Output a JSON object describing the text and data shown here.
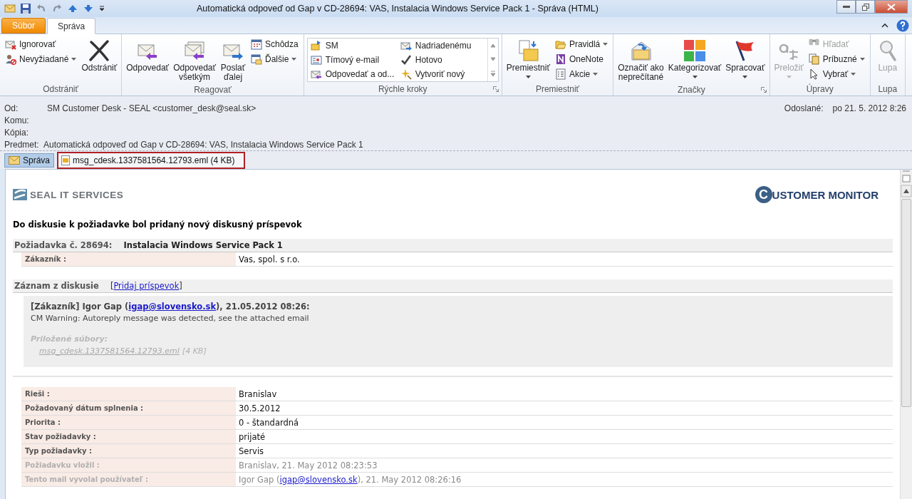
{
  "window": {
    "title": "Automatická odpoveď od Gap v CD-28694: VAS,  Instalacia Windows Service Pack 1 -  Správa (HTML)"
  },
  "ribbon_tabs": [
    {
      "label": "Súbor",
      "kind": "file",
      "selected": false
    },
    {
      "label": "Správa",
      "kind": "tab",
      "selected": true
    }
  ],
  "ribbon_groups": [
    {
      "label": "Odstrániť",
      "launcher": false,
      "columns": [
        {
          "kind": "stack",
          "items": [
            {
              "label": "Ignorovať",
              "dropdown": false,
              "disabled": false
            },
            {
              "label": "Nevyžiadané",
              "dropdown": true,
              "disabled": false
            }
          ]
        },
        {
          "kind": "large",
          "lines": [
            "Odstrániť"
          ],
          "dropdown": false,
          "disabled": false
        }
      ]
    },
    {
      "label": "Reagovať",
      "launcher": false,
      "columns": [
        {
          "kind": "large",
          "lines": [
            "Odpovedať"
          ],
          "dropdown": false,
          "disabled": false
        },
        {
          "kind": "large",
          "lines": [
            "Odpovedať",
            "všetkým"
          ],
          "dropdown": false,
          "disabled": false
        },
        {
          "kind": "large",
          "lines": [
            "Poslať",
            "ďalej"
          ],
          "dropdown": false,
          "disabled": false
        },
        {
          "kind": "stack",
          "items": [
            {
              "label": "Schôdza",
              "dropdown": false,
              "disabled": false
            },
            {
              "label": "Ďalšie",
              "dropdown": true,
              "disabled": false
            }
          ]
        }
      ]
    },
    {
      "label": "Rýchle kroky",
      "launcher": true,
      "columns": [
        {
          "kind": "gallery",
          "items": [
            {
              "label": "SM"
            },
            {
              "label": "Tímový e-mail"
            },
            {
              "label": "Odpovedať a od..."
            },
            {
              "label": "Nadriadenému"
            },
            {
              "label": "Hotovo"
            },
            {
              "label": "Vytvoriť nový"
            }
          ]
        }
      ]
    },
    {
      "label": "Premiestniť",
      "launcher": false,
      "columns": [
        {
          "kind": "large",
          "lines": [
            "Premiestniť"
          ],
          "dropdown": true,
          "disabled": false
        },
        {
          "kind": "stack",
          "items": [
            {
              "label": "Pravidlá",
              "dropdown": true,
              "disabled": false
            },
            {
              "label": "OneNote",
              "dropdown": false,
              "disabled": false
            },
            {
              "label": "Akcie",
              "dropdown": true,
              "disabled": false
            }
          ]
        }
      ]
    },
    {
      "label": "Značky",
      "launcher": true,
      "columns": [
        {
          "kind": "large",
          "lines": [
            "Označiť ako",
            "neprečítané"
          ],
          "dropdown": false,
          "disabled": false
        },
        {
          "kind": "large",
          "lines": [
            "Kategorizovať"
          ],
          "dropdown": true,
          "disabled": false
        },
        {
          "kind": "large",
          "lines": [
            "Spracovať"
          ],
          "dropdown": true,
          "disabled": false
        }
      ]
    },
    {
      "label": "Úpravy",
      "launcher": false,
      "columns": [
        {
          "kind": "large",
          "lines": [
            "Preložiť"
          ],
          "dropdown": true,
          "disabled": true
        },
        {
          "kind": "stack",
          "items": [
            {
              "label": "Hľadať",
              "dropdown": false,
              "disabled": true
            },
            {
              "label": "Príbuzné",
              "dropdown": true,
              "disabled": false
            },
            {
              "label": "Vybrať",
              "dropdown": true,
              "disabled": false
            }
          ]
        }
      ]
    },
    {
      "label": "Lupa",
      "launcher": false,
      "columns": [
        {
          "kind": "large",
          "lines": [
            "Lupa"
          ],
          "dropdown": false,
          "disabled": true
        }
      ]
    }
  ],
  "header": {
    "fields": [
      {
        "label": "Od:",
        "value": "SM Customer Desk - SEAL <customer_desk@seal.sk>"
      },
      {
        "label": "Komu:"
      },
      {
        "label": "Kópia:"
      },
      {
        "label": "Predmet:",
        "value": "Automatická odpoveď od Gap v CD-28694: VAS,  Instalacia Windows Service Pack 1"
      }
    ],
    "sent": {
      "label": "Odoslané:",
      "value": "po 21. 5. 2012 8:26"
    }
  },
  "message_tabs": [
    {
      "label": "Správa",
      "kind": "message",
      "selected": true,
      "highlighted": false
    },
    {
      "label": "msg_cdesk.1337581564.12793.eml (4 KB)",
      "kind": "attachment",
      "selected": false,
      "highlighted": true
    }
  ],
  "body": {
    "logo_left": "SEAL IT SERVICES",
    "logo_right": {
      "initial": "C",
      "text": "USTOMER MONITOR"
    },
    "heading": "Do diskusie k požiadavke bol pridaný nový diskusný príspevok",
    "request": {
      "label": "Požiadavka č. 28694:",
      "title": "Instalacia Windows Service Pack 1"
    },
    "customer": {
      "label": "Zákazník :",
      "value": "Vas, spol. s r.o."
    },
    "discussion": {
      "label": "Záznam z diskusie",
      "link_prefix": "[",
      "link": "Pridaj príspevok",
      "link_suffix": "]"
    },
    "entry": {
      "author_before": "[Zákazník] Igor Gap (",
      "email": "igap@slovensko.sk",
      "author_after": "), 21.05.2012 08:26:",
      "text": "CM Warning: Autoreply message was detected, see the attached email",
      "attachments_label": "Priložené súbory:",
      "attachment": "msg_cdesk.1337581564.12793.eml",
      "attachment_size": "[4 KB]"
    },
    "details": [
      {
        "label": "Rieši :",
        "value": "Branislav",
        "muted": false
      },
      {
        "label": "Požadovaný dátum splnenia :",
        "value": "30.5.2012",
        "muted": false
      },
      {
        "label": "Priorita :",
        "value": "0 - štandardná",
        "muted": false
      },
      {
        "label": "Stav požiadavky :",
        "value": "prijaté",
        "muted": false
      },
      {
        "label": "Typ požiadavky :",
        "value": "Servis",
        "muted": false
      },
      {
        "label": "Požiadavku vložil :",
        "value": "Branislav, 21. May 2012 08:23:53",
        "muted": true
      },
      {
        "label": "Tento mail vyvolal používateľ :",
        "value": "Igor Gap (",
        "email": "igap@slovensko.sk",
        "value_after": "), 21. May 2012 08:26:16",
        "muted": true
      }
    ]
  }
}
